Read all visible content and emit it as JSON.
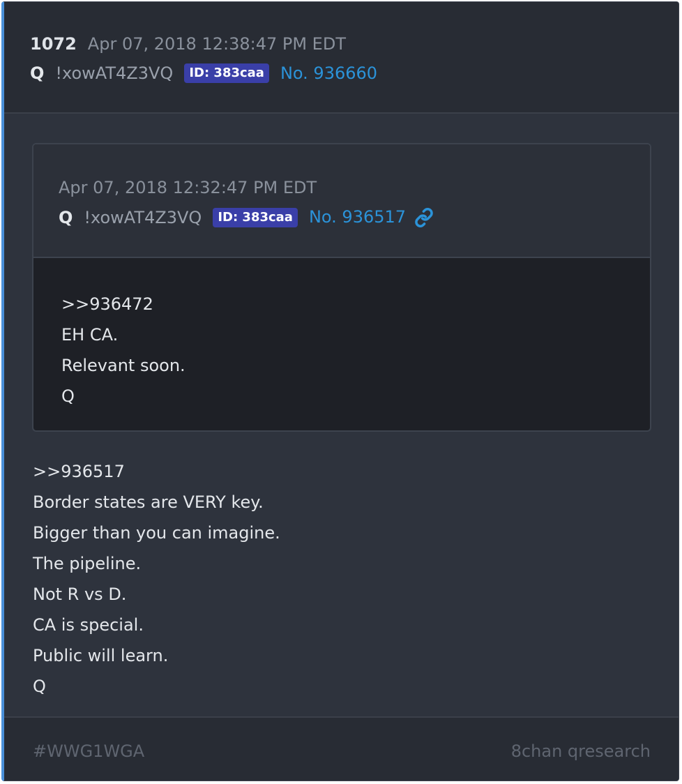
{
  "post": {
    "number": "1072",
    "timestamp": "Apr 07, 2018 12:38:47 PM EDT",
    "author": "Q",
    "tripcode": "!xowAT4Z3VQ",
    "id_badge": "ID: 383caa",
    "post_link": "No. 936660"
  },
  "quoted": {
    "timestamp": "Apr 07, 2018 12:32:47 PM EDT",
    "author": "Q",
    "tripcode": "!xowAT4Z3VQ",
    "id_badge": "ID: 383caa",
    "post_link": "No. 936517",
    "link_icon": "link-icon",
    "lines": [
      ">>936472",
      "EH CA.",
      "Relevant soon.",
      "Q"
    ]
  },
  "body": {
    "lines": [
      ">>936517",
      "Border states are VERY key.",
      "Bigger than you can imagine.",
      "The pipeline.",
      "Not R vs D.",
      "CA is special.",
      "Public will learn.",
      "Q"
    ]
  },
  "footer": {
    "hashtag": "#WWG1WGA",
    "source": "8chan qresearch"
  },
  "colors": {
    "accent": "#4a90d9",
    "link": "#2b93d9",
    "badge": "#3a3fa8",
    "background": "#2e333d"
  }
}
